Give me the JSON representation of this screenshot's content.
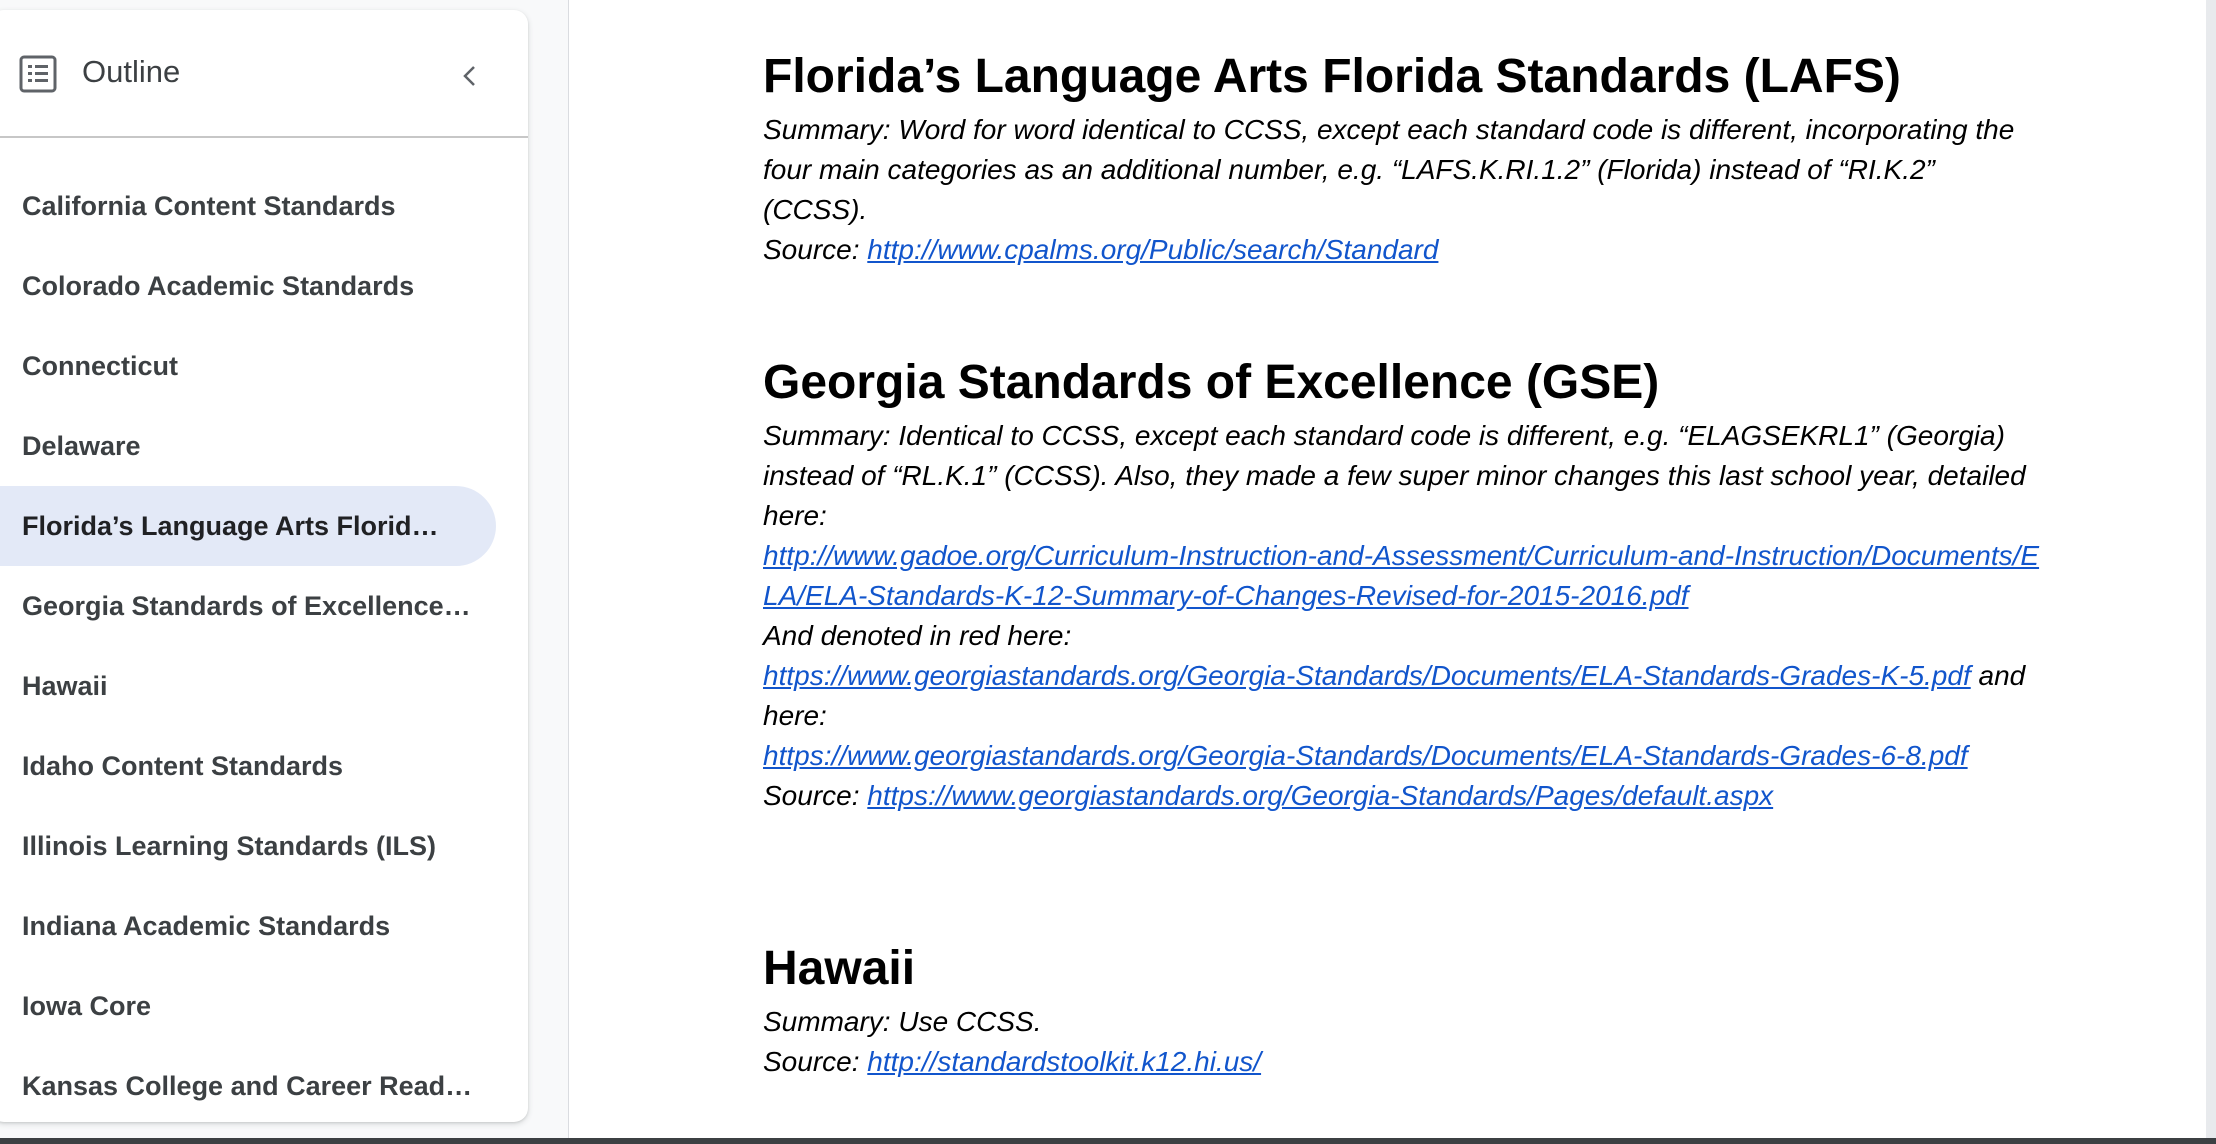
{
  "sidebar": {
    "title": "Outline",
    "items": [
      {
        "label": "California Content Standards"
      },
      {
        "label": "Colorado Academic Standards"
      },
      {
        "label": "Connecticut"
      },
      {
        "label": "Delaware"
      },
      {
        "label": "Florida’s Language Arts Florida St…"
      },
      {
        "label": "Georgia Standards of Excellence (…"
      },
      {
        "label": "Hawaii"
      },
      {
        "label": "Idaho Content Standards"
      },
      {
        "label": "Illinois Learning Standards (ILS)"
      },
      {
        "label": "Indiana Academic Standards"
      },
      {
        "label": "Iowa Core"
      },
      {
        "label": "Kansas College and Career Ready…"
      }
    ],
    "active_index": 4
  },
  "doc": {
    "florida": {
      "heading": "Florida’s Language Arts Florida Standards (LAFS)",
      "summary": "Summary: Word for word identical to CCSS, except each standard code is different, incorporating the four main categories as an additional number, e.g. “LAFS.K.RI.1.2” (Florida) instead of “RI.K.2” (CCSS).",
      "source_label": "Source: ",
      "source_link": "http://www.cpalms.org/Public/search/Standard"
    },
    "georgia": {
      "heading": "Georgia Standards of Excellence (GSE)",
      "summary": "Summary: Identical to CCSS, except each standard code is different, e.g. “ELAGSEKRL1” (Georgia) instead of “RL.K.1” (CCSS). Also, they made a few super minor changes this last school year, detailed here:",
      "changes_link": "http://www.gadoe.org/Curriculum-Instruction-and-Assessment/Curriculum-and-Instruction/Documents/ELA/ELA-Standards-K-12-Summary-of-Changes-Revised-for-2015-2016.pdf",
      "denoted_text": "And denoted in red here:",
      "red_link_1": "https://www.georgiastandards.org/Georgia-Standards/Documents/ELA-Standards-Grades-K-5.pdf",
      "and_here_text": " and here:",
      "red_link_2": "https://www.georgiastandards.org/Georgia-Standards/Documents/ELA-Standards-Grades-6-8.pdf",
      "source_label": "Source: ",
      "source_link": "https://www.georgiastandards.org/Georgia-Standards/Pages/default.aspx"
    },
    "hawaii": {
      "heading": "Hawaii",
      "summary": "Summary: Use CCSS.",
      "source_label": "Source: ",
      "source_link": "http://standardstoolkit.k12.hi.us/"
    }
  },
  "icons": {
    "outline": "list-outline-icon",
    "collapse": "chevron-left-icon"
  }
}
